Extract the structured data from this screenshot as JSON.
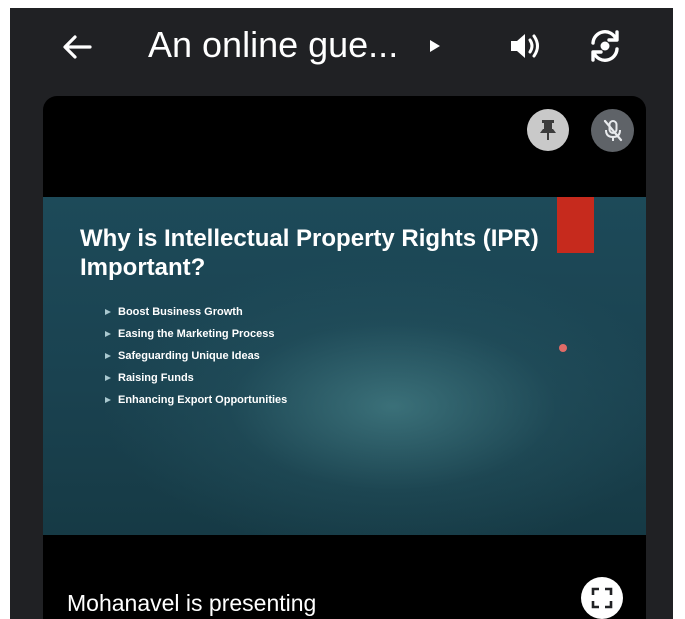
{
  "topbar": {
    "title": "An online gue...",
    "back_icon": "arrow-left-icon",
    "chevron_icon": "chevron-right-icon",
    "speaker_icon": "speaker-icon",
    "switch_camera_icon": "switch-camera-icon"
  },
  "tile": {
    "pin_icon": "pin-icon",
    "mic_off_icon": "mic-off-icon",
    "presenter_text": "Mohanavel is presenting",
    "fullscreen_icon": "fullscreen-icon"
  },
  "slide": {
    "title": "Why is Intellectual Property Rights (IPR) Important?",
    "bullets": [
      "Boost Business Growth",
      "Easing the Marketing Process",
      "Safeguarding Unique Ideas",
      "Raising Funds",
      "Enhancing Export Opportunities"
    ],
    "colors": {
      "background": "#1d4a59",
      "accent_bar": "#c62a1d",
      "accent_dot": "#e06b67"
    }
  },
  "colors": {
    "app_background": "#202124",
    "tile_background": "#000000",
    "text": "#ffffff"
  }
}
